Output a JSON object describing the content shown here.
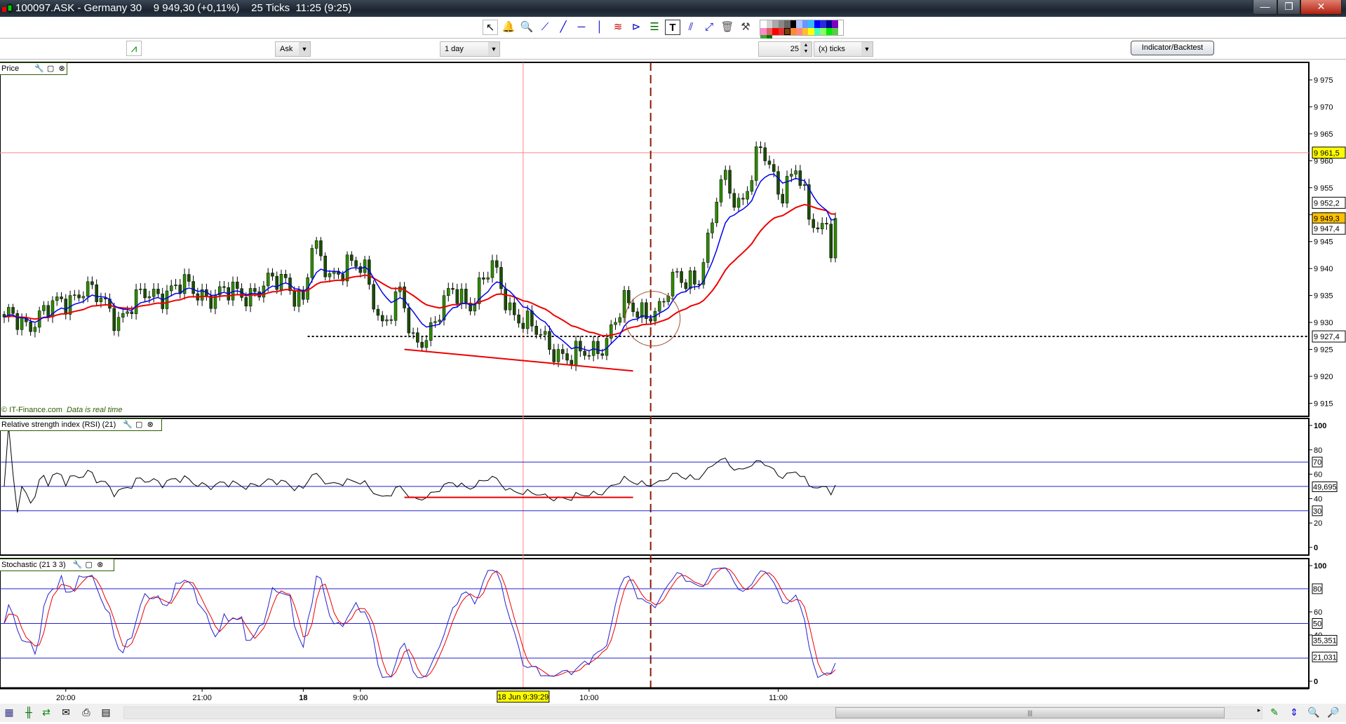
{
  "window": {
    "title": "100097.ASK - Germany 30    9 949,30 (+0,11%)    25 Ticks  11:25 (9:25)",
    "minimize": "—",
    "restore": "❐",
    "close": "✕"
  },
  "toolbar": {
    "tools": [
      "cursor-tool",
      "alarm-tool",
      "zoom-tool",
      "line-tool",
      "extended-line-tool",
      "horizontal-line-tool",
      "vertical-line-tool",
      "channel-tool",
      "fibonacci-fan-tool",
      "regression-tool",
      "text-tool",
      "parallel-line-tool",
      "segment-tool",
      "delete-tool",
      "settings-tool"
    ],
    "palette": [
      "#ffffff",
      "#d4d4d4",
      "#a8a8a8",
      "#888888",
      "#666666",
      "#000000",
      "#b0c4ff",
      "#6699ff",
      "#33bbff",
      "#0000ff",
      "#2a2adc",
      "#000099",
      "#7f00c0",
      "#ff88cc",
      "#e06060",
      "#ff0000",
      "#dd3333",
      "#7f3f00",
      "#ff8833",
      "#ff8877",
      "#ffbb33",
      "#ffff00",
      "#44ffbb",
      "#88ff66",
      "#00ee00",
      "#55cc44",
      "#33aa33",
      "#007700"
    ],
    "price_type": "Ask",
    "period": "1 day",
    "ticks_value": "25",
    "ticks_unit": "(x) ticks",
    "indicator_button": "Indicator/Backtest"
  },
  "panels": {
    "price": {
      "title": "Price",
      "watermark": "© IT-Finance.com",
      "realtime": "Data is real time"
    },
    "rsi": {
      "title": "Relative strength index (RSI) (21)"
    },
    "stoch": {
      "title": "Stochastic (21 3 3)"
    }
  },
  "chart_data": {
    "type": "candlestick",
    "symbol": "Germany 30",
    "bars": 190,
    "close_keypoints": [
      [
        0,
        9931
      ],
      [
        5,
        9930
      ],
      [
        12,
        9933
      ],
      [
        18,
        9936.5
      ],
      [
        26,
        9931
      ],
      [
        32,
        9935
      ],
      [
        40,
        9936.5
      ],
      [
        48,
        9935
      ],
      [
        56,
        9935.7
      ],
      [
        64,
        9938
      ],
      [
        68,
        9934
      ],
      [
        70,
        9943.6
      ],
      [
        74,
        9939
      ],
      [
        78,
        9941
      ],
      [
        82,
        9939
      ],
      [
        86,
        9930
      ],
      [
        90,
        9935
      ],
      [
        93,
        9926
      ],
      [
        97,
        9929
      ],
      [
        102,
        9935.7
      ],
      [
        106,
        9934
      ],
      [
        111,
        9940
      ],
      [
        115,
        9933
      ],
      [
        120,
        9928.5
      ],
      [
        124,
        9926
      ],
      [
        129,
        9923
      ],
      [
        133,
        9924.5
      ],
      [
        137,
        9927
      ],
      [
        141,
        9933
      ],
      [
        145,
        9932.5
      ],
      [
        149,
        9931.7
      ],
      [
        153,
        9939
      ],
      [
        158,
        9938
      ],
      [
        160,
        9943.6
      ],
      [
        162,
        9953
      ],
      [
        164,
        9958
      ],
      [
        167,
        9951.6
      ],
      [
        170,
        9956
      ],
      [
        172,
        9962.7
      ],
      [
        174,
        9959.5
      ],
      [
        177,
        9954
      ],
      [
        180,
        9958
      ],
      [
        183,
        9950
      ],
      [
        186,
        9947.6
      ],
      [
        187,
        9950
      ],
      [
        188,
        9943
      ],
      [
        189,
        9949.3
      ]
    ],
    "price_axis": {
      "min": 9912,
      "max": 9979,
      "ticks": [
        "9 975",
        "9 970",
        "9 965",
        "9 960",
        "9 955",
        "9 950",
        "9 945",
        "9 940",
        "9 935",
        "9 930",
        "9 925",
        "9 920",
        "9 915"
      ],
      "tick_values": [
        9975,
        9970,
        9965,
        9960,
        9955,
        9950,
        9945,
        9940,
        9935,
        9930,
        9925,
        9920,
        9915
      ]
    },
    "value_boxes": [
      {
        "label": "9 961,5",
        "value": 9961.5,
        "bg": "#ffff00",
        "color": "#000000"
      },
      {
        "label": "9 952,2",
        "value": 9952.2,
        "bg": "#ffffff",
        "color": "#ff0000"
      },
      {
        "label": "9 949,3",
        "value": 9949.3,
        "bg": "#ffc000",
        "color": "#000000"
      },
      {
        "label": "9 947,4",
        "value": 9947.4,
        "bg": "#ffffff",
        "color": "#0000ff"
      },
      {
        "label": "9 927,4",
        "value": 9927.4,
        "bg": "#ffffff",
        "color": "#000000"
      }
    ],
    "ma_fast_color": "#0000ee",
    "ma_slow_color": "#ee0000",
    "candle_color": "#2e8b00",
    "rsi_axis": {
      "ticks": [
        "100",
        "80",
        "60",
        "40",
        "20",
        "0"
      ],
      "tick_values": [
        100,
        80,
        60,
        40,
        20,
        0
      ],
      "levels": [
        70,
        50,
        30
      ],
      "level_labels": [
        "70",
        "30"
      ],
      "value_label": "49,695"
    },
    "stoch_axis": {
      "ticks": [
        "100",
        "60",
        "40",
        "0"
      ],
      "tick_values": [
        100,
        60,
        40,
        0
      ],
      "levels": [
        80,
        50,
        20
      ],
      "level_labels": [
        "80",
        "50"
      ],
      "k_label": "35,351",
      "d_label": "21,031"
    },
    "time_axis": [
      {
        "label": "20:00",
        "bar": 14
      },
      {
        "label": "21:00",
        "bar": 45
      },
      {
        "label": "18",
        "bar": 68
      },
      {
        "label": "9:00",
        "bar": 81
      },
      {
        "label": "10:00",
        "bar": 133
      },
      {
        "label": "11:00",
        "bar": 176
      }
    ],
    "cursor_label": "18 Jun 9:39:29",
    "cursor_bar": 118,
    "marker_bar": 147,
    "support_level": 9927.4,
    "cursor_price": 9961.5,
    "trendline_price": [
      [
        91,
        9925
      ],
      [
        143,
        9921
      ]
    ],
    "rsi_trendline": [
      [
        91,
        41
      ],
      [
        143,
        41
      ]
    ]
  },
  "statusbar": {
    "tools": [
      "calendar",
      "chart-type",
      "compare",
      "mail",
      "print",
      "save"
    ],
    "zoom_tools": [
      "draw",
      "zoom-fit",
      "zoom-out",
      "zoom-in"
    ],
    "scroll_grip": "|||"
  }
}
